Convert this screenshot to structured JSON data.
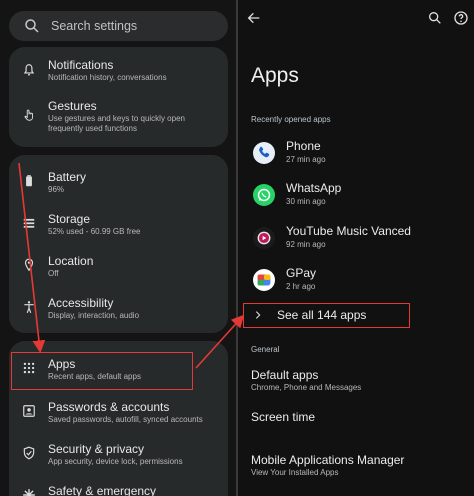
{
  "left": {
    "search_placeholder": "Search settings",
    "items_top": [
      {
        "title": "Notifications",
        "sub": "Notification history, conversations",
        "icon": "bell-icon"
      },
      {
        "title": "Gestures",
        "sub": "Use gestures and keys to quickly open frequently used functions",
        "icon": "gesture-icon"
      }
    ],
    "items_mid": [
      {
        "title": "Battery",
        "sub": "96%",
        "icon": "battery-icon"
      },
      {
        "title": "Storage",
        "sub": "52% used - 60.99 GB free",
        "icon": "storage-icon"
      },
      {
        "title": "Location",
        "sub": "Off",
        "icon": "location-icon"
      },
      {
        "title": "Accessibility",
        "sub": "Display, interaction, audio",
        "icon": "accessibility-icon"
      }
    ],
    "items_bottom": [
      {
        "title": "Apps",
        "sub": "Recent apps, default apps",
        "icon": "apps-grid-icon"
      },
      {
        "title": "Passwords & accounts",
        "sub": "Saved passwords, autofill, synced accounts",
        "icon": "account-icon"
      },
      {
        "title": "Security & privacy",
        "sub": "App security, device lock, permissions",
        "icon": "shield-icon"
      },
      {
        "title": "Safety & emergency",
        "sub": "",
        "icon": "emergency-icon"
      }
    ]
  },
  "right": {
    "title": "Apps",
    "recent_header": "Recently opened apps",
    "apps": [
      {
        "name": "Phone",
        "time": "27 min ago",
        "icon": "phone-app-icon"
      },
      {
        "name": "WhatsApp",
        "time": "30 min ago",
        "icon": "whatsapp-app-icon"
      },
      {
        "name": "YouTube Music Vanced",
        "time": "92 min ago",
        "icon": "youtube-music-app-icon"
      },
      {
        "name": "GPay",
        "time": "2 hr ago",
        "icon": "gpay-app-icon"
      }
    ],
    "see_all": "See all 144 apps",
    "general_header": "General",
    "default_apps": {
      "title": "Default apps",
      "sub": "Chrome, Phone and Messages"
    },
    "screen_time": "Screen time",
    "mam": {
      "title": "Mobile Applications Manager",
      "sub": "View Your Installed Apps"
    }
  },
  "colors": {
    "highlight": "#e53935",
    "card": "#272a2b",
    "accent": "#8ab4f8"
  }
}
